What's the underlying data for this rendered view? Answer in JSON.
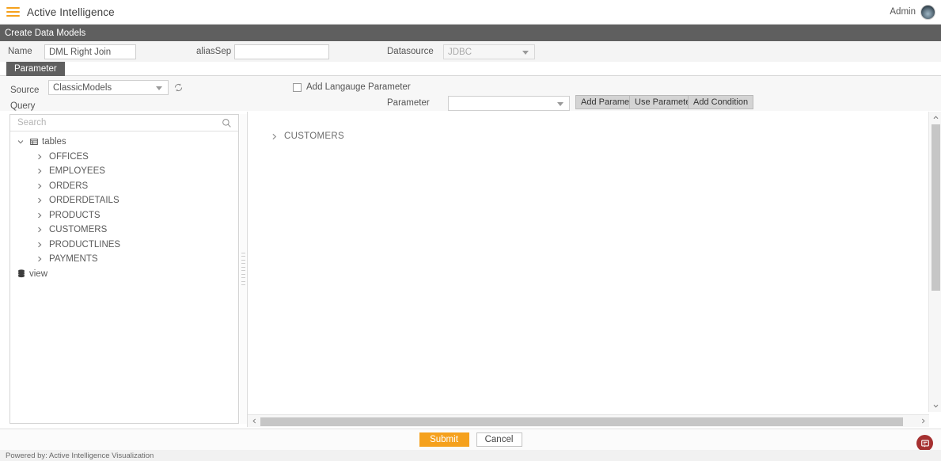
{
  "appbar": {
    "menu_icon": "hamburger-icon",
    "title": "Active Intelligence",
    "user_label": "Admin",
    "avatar_icon": "user-avatar"
  },
  "titlebar": {
    "title": "Create Data Models"
  },
  "form": {
    "name_label": "Name",
    "name_value": "DML Right Join",
    "alias_label": "aliasSep",
    "alias_value": "",
    "alias_placeholder": "",
    "datasource_label": "Datasource",
    "datasource_value": "JDBC"
  },
  "tabs": {
    "parameter_label": "Parameter"
  },
  "source": {
    "source_label": "Source",
    "source_value": "ClassicModels",
    "refresh_icon": "refresh-icon",
    "query_label": "Query"
  },
  "language": {
    "checkbox_label": "Add Langauge Parameter",
    "checked": false
  },
  "parameter": {
    "label": "Parameter",
    "value": "",
    "add_parameter_label": "Add Parameter",
    "use_parameter_label": "Use Parameter",
    "add_condition_label": "Add Condition"
  },
  "tree": {
    "search_placeholder": "Search",
    "search_value": "",
    "search_icon": "search-icon",
    "root": {
      "label": "tables",
      "icon": "table-icon",
      "expanded": true
    },
    "tables": [
      {
        "label": "OFFICES"
      },
      {
        "label": "EMPLOYEES"
      },
      {
        "label": "ORDERS"
      },
      {
        "label": "ORDERDETAILS"
      },
      {
        "label": "PRODUCTS"
      },
      {
        "label": "CUSTOMERS"
      },
      {
        "label": "PRODUCTLINES"
      },
      {
        "label": "PAYMENTS"
      }
    ],
    "view": {
      "label": "view",
      "icon": "database-icon"
    }
  },
  "canvas": {
    "nodes": [
      {
        "label": "CUSTOMERS"
      }
    ]
  },
  "actions": {
    "submit_label": "Submit",
    "cancel_label": "Cancel"
  },
  "footer": {
    "text": "Powered by: Active Intelligence Visualization",
    "help_icon": "feedback-icon"
  },
  "colors": {
    "accent": "#f5a11d",
    "titlebar": "#5f5f5f",
    "help": "#a63131"
  }
}
